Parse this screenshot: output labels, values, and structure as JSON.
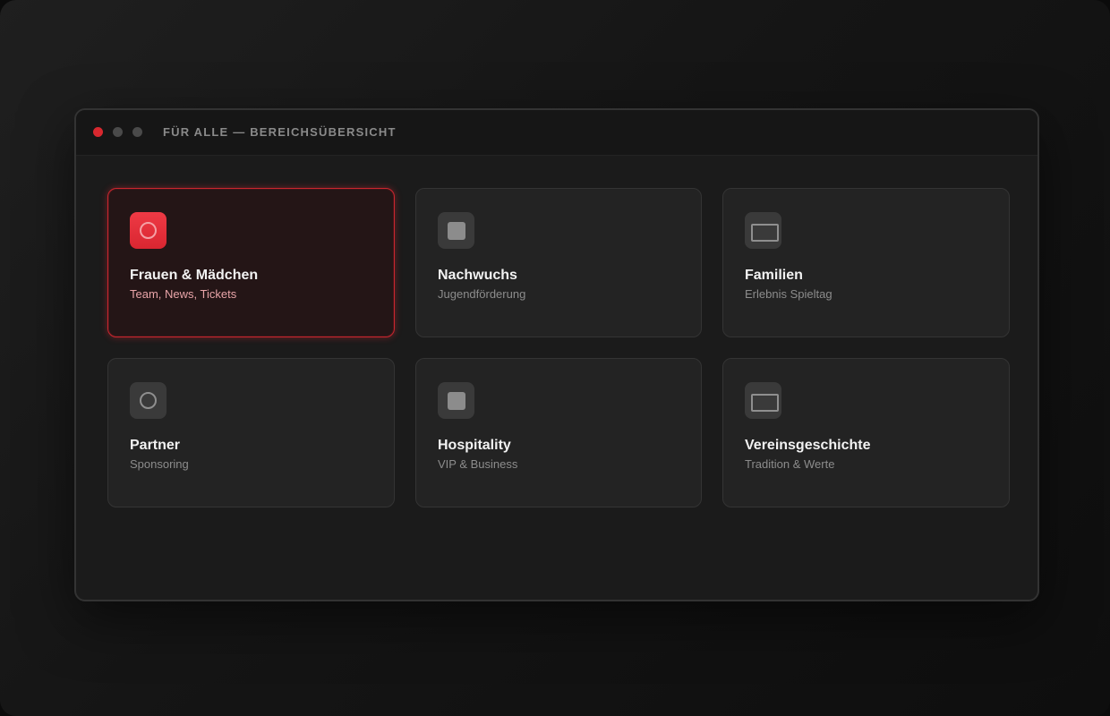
{
  "window": {
    "title": "FÜR ALLE — BEREICHSÜBERSICHT"
  },
  "colors": {
    "accent": "#d8282f",
    "card_bg": "#232323",
    "active_card_bg": "#241516"
  },
  "cards": [
    {
      "title": "Frauen & Mädchen",
      "subtitle": "Team, News, Tickets",
      "icon": "circle-icon",
      "active": true
    },
    {
      "title": "Nachwuchs",
      "subtitle": "Jugendförderung",
      "icon": "square-icon",
      "active": false
    },
    {
      "title": "Familien",
      "subtitle": "Erlebnis Spieltag",
      "icon": "rectangle-icon",
      "active": false
    },
    {
      "title": "Partner",
      "subtitle": "Sponsoring",
      "icon": "circle-icon",
      "active": false
    },
    {
      "title": "Hospitality",
      "subtitle": "VIP & Business",
      "icon": "square-icon",
      "active": false
    },
    {
      "title": "Vereinsgeschichte",
      "subtitle": "Tradition & Werte",
      "icon": "rectangle-icon",
      "active": false
    }
  ]
}
